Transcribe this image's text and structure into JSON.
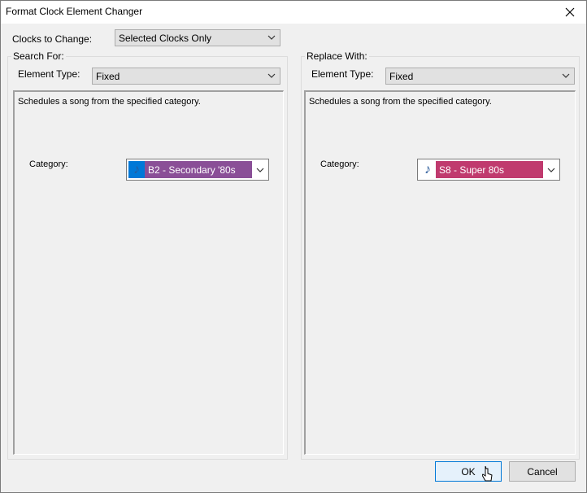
{
  "window": {
    "title": "Format Clock Element Changer"
  },
  "clocks": {
    "label": "Clocks to Change:",
    "value": "Selected Clocks Only"
  },
  "search": {
    "legend": "Search For:",
    "element_label": "Element Type:",
    "element_value": "Fixed",
    "description": "Schedules a song from the specified category.",
    "category_label": "Category:",
    "category_value": "B2 - Secondary '80s",
    "category_color": "#8a4f97"
  },
  "replace": {
    "legend": "Replace With:",
    "element_label": "Element Type:",
    "element_value": "Fixed",
    "description": "Schedules a song from the specified category.",
    "category_label": "Category:",
    "category_value": "S8 - Super 80s",
    "category_color": "#c03a6e"
  },
  "buttons": {
    "ok": "OK",
    "cancel": "Cancel"
  },
  "icons": {
    "close": "close-icon",
    "dropdown": "chevron-down-icon",
    "music": "music-note-icon",
    "pointer": "mouse-pointer-icon"
  }
}
